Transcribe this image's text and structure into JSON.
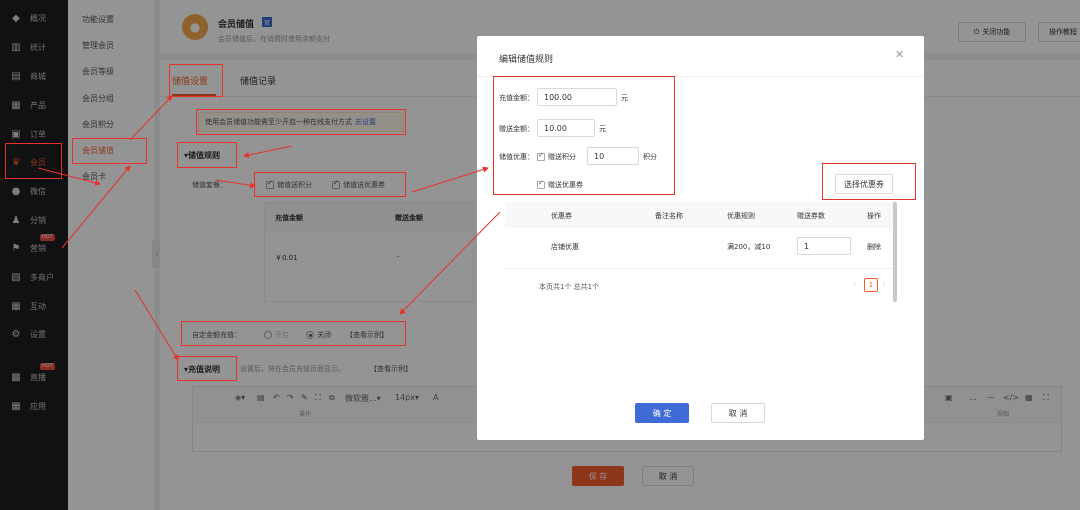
{
  "sidebar": {
    "items": [
      {
        "label": "概况",
        "icon": "dashboard-icon",
        "glyph": "◆"
      },
      {
        "label": "统计",
        "icon": "chart-icon",
        "glyph": "▥"
      },
      {
        "label": "商城",
        "icon": "store-icon",
        "glyph": "▤"
      },
      {
        "label": "产品",
        "icon": "product-icon",
        "glyph": "▦"
      },
      {
        "label": "订单",
        "icon": "order-icon",
        "glyph": "▣"
      },
      {
        "label": "会员",
        "icon": "crown-icon",
        "glyph": "♛"
      },
      {
        "label": "微信",
        "icon": "wechat-icon",
        "glyph": "●"
      },
      {
        "label": "分销",
        "icon": "distribution-icon",
        "glyph": "♟"
      },
      {
        "label": "营销",
        "icon": "flag-icon",
        "glyph": "⚑",
        "badge": "HOT"
      },
      {
        "label": "多商户",
        "icon": "merchant-icon",
        "glyph": "▧"
      },
      {
        "label": "互动",
        "icon": "interact-icon",
        "glyph": "▦"
      },
      {
        "label": "设置",
        "icon": "gear-icon",
        "glyph": "⚙"
      },
      {
        "label": "直播",
        "icon": "tv-icon",
        "glyph": "▩",
        "badge": "HOT"
      },
      {
        "label": "应用",
        "icon": "apps-icon",
        "glyph": "▦"
      }
    ]
  },
  "subnav": {
    "items": [
      "功能设置",
      "管理会员",
      "会员等级",
      "会员分组",
      "会员积分",
      "会员储值",
      "会员卡"
    ]
  },
  "header": {
    "title": "会员储值",
    "badge": "官",
    "desc": "会员储值后，在消费时使用余额支付",
    "close_label": "关闭功能",
    "tutorial_label": "操作教程"
  },
  "tabs": [
    "储值设置",
    "储值记录"
  ],
  "notice": {
    "text": "使用会员储值功能需至少开启一种在线支付方式",
    "link": "去设置"
  },
  "rules": {
    "title": "储值规则",
    "package_label": "储值套餐：",
    "opt1": "储值送积分",
    "opt2": "储值送优惠券"
  },
  "pkg_table": {
    "col1": "充值金额",
    "col2": "赠送金额",
    "row_amount": "￥0.01",
    "row_gift": "-"
  },
  "custom_amount": {
    "label": "自定金额充值：",
    "on": "开启",
    "off": "关闭",
    "example": "【查看示例】"
  },
  "desc_section": {
    "title": "充值说明",
    "hint": "设置后，将在会员充值页面显示。",
    "example": "【查看示例】"
  },
  "editor": {
    "font": "微软雅...",
    "size": "14px",
    "tools_label": "操作",
    "view_label": "视图"
  },
  "page_actions": {
    "save": "保 存",
    "cancel": "取 消"
  },
  "modal": {
    "title": "编辑储值规则",
    "recharge_label": "充值金额：",
    "recharge_value": "100.00",
    "gift_label": "赠送金额：",
    "gift_value": "10.00",
    "unit_yuan": "元",
    "bonus_label": "储值优惠：",
    "points_label": "赠送积分",
    "points_value": "10",
    "points_unit": "积分",
    "coupon_label": "赠送优惠券",
    "choose_coupon": "选择优惠券",
    "coupon_table": {
      "headers": [
        "优惠券",
        "备注名称",
        "优惠规则",
        "赠送券数",
        "操作"
      ],
      "row": {
        "name": "店铺优惠",
        "note": "",
        "rule": "满200，减10",
        "qty": "1",
        "action": "删除"
      }
    },
    "pager_text": "本页共1个 总共1个",
    "page_current": "1",
    "confirm": "确 定",
    "cancel": "取 消"
  },
  "colors": {
    "accent": "#f55d2c",
    "primary": "#3f6bd6",
    "annotation": "#e8322a"
  }
}
